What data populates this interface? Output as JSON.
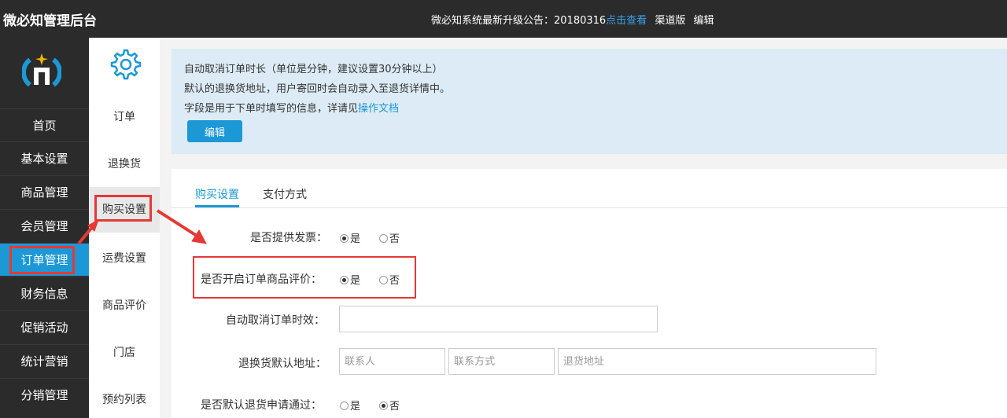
{
  "app": {
    "title": "微必知管理后台"
  },
  "notice": {
    "text": "微必知系统最新升级公告：20180316",
    "link": "点击查看",
    "channel": "渠道版",
    "edit": "编辑"
  },
  "leftnav": {
    "items": [
      "首页",
      "基本设置",
      "商品管理",
      "会员管理",
      "订单管理",
      "财务信息",
      "促销活动",
      "统计营销",
      "分销管理"
    ],
    "active": "订单管理"
  },
  "subnav": {
    "items": [
      "订单",
      "退换货",
      "购买设置",
      "运费设置",
      "商品评价",
      "门店",
      "预约列表"
    ],
    "active": "购买设置"
  },
  "info": {
    "line1": "自动取消订单时长（单位是分钟，建议设置30分钟以上）",
    "line2": "默认的退换货地址，用户寄回时会自动录入至退货详情中。",
    "line3_prefix": "字段是用于下单时填写的信息，详请见",
    "line3_link": "操作文档",
    "edit_button": "编辑"
  },
  "tabs": [
    {
      "label": "购买设置",
      "active": true
    },
    {
      "label": "支付方式",
      "active": false
    }
  ],
  "form": {
    "invoice": {
      "label": "是否提供发票：",
      "yes": "是",
      "no": "否",
      "selected": "是"
    },
    "review": {
      "label": "是否开启订单商品评价：",
      "yes": "是",
      "no": "否",
      "selected": "是"
    },
    "auto_cancel": {
      "label": "自动取消订单时效：",
      "value": ""
    },
    "return_address": {
      "label": "退换货默认地址：",
      "contact_placeholder": "联系人",
      "phone_placeholder": "联系方式",
      "address_placeholder": "退货地址"
    },
    "auto_return": {
      "label": "是否默认退货申请通过：",
      "yes": "是",
      "no": "否",
      "selected": "否"
    }
  },
  "colors": {
    "accent": "#1c98d6",
    "highlight": "#e53935",
    "topbar": "#2b2b2b"
  }
}
